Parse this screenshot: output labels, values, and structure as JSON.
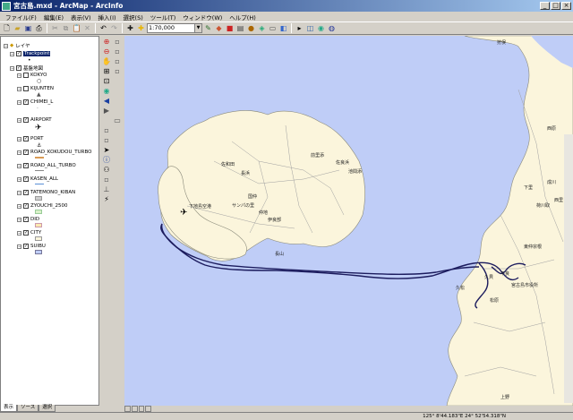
{
  "window": {
    "title": "宮古島.mxd - ArcMap - ArcInfo",
    "minimize": "_",
    "maximize": "□",
    "close": "×"
  },
  "menu": [
    "ファイル(F)",
    "編集(E)",
    "表示(V)",
    "挿入(I)",
    "選択(S)",
    "ツール(T)",
    "ウィンドウ(W)",
    "ヘルプ(H)"
  ],
  "toolbar": {
    "scale_value": "1:70,000"
  },
  "toc": {
    "root_label": "レイヤ",
    "layers": [
      {
        "label": "Trackpoint",
        "selected": true
      },
      {
        "label": "基盤地図"
      },
      {
        "label": "KOKYO"
      },
      {
        "label": "KIJUNTEN"
      },
      {
        "label": "CHIMEI_L"
      },
      {
        "label": "AIRPORT"
      },
      {
        "label": "PORT"
      },
      {
        "label": "ROAD_KOKUDOU_TURBO"
      },
      {
        "label": "ROAD_ALL_TURBO"
      },
      {
        "label": "KASEN_ALL"
      },
      {
        "label": "TATEMONO_KIBAN"
      },
      {
        "label": "ZYOUCHI_2500"
      },
      {
        "label": "DID"
      },
      {
        "label": "CITY"
      },
      {
        "label": "SUIBU"
      }
    ],
    "tabs": [
      "表示",
      "ソース",
      "選択"
    ]
  },
  "map": {
    "colors": {
      "sea": "#bfcdf7",
      "land": "#fbf5dc",
      "road": "#a0a0a0",
      "track": "#1c1c5e"
    },
    "place_labels": [
      "佐和田",
      "長浜",
      "佐良浜",
      "前里添",
      "池間添",
      "国仲",
      "サンパの里",
      "仲地",
      "伊良部",
      "下地島空港",
      "長山",
      "成川",
      "西里",
      "荷川取",
      "下里",
      "東仲宗根",
      "久松",
      "松原",
      "宮古島市役所",
      "平良",
      "久貝",
      "上野",
      "西原",
      "狩俣"
    ]
  },
  "status": {
    "coords": "125° 8'44.183\"E  24° 52'54.318\"N"
  }
}
